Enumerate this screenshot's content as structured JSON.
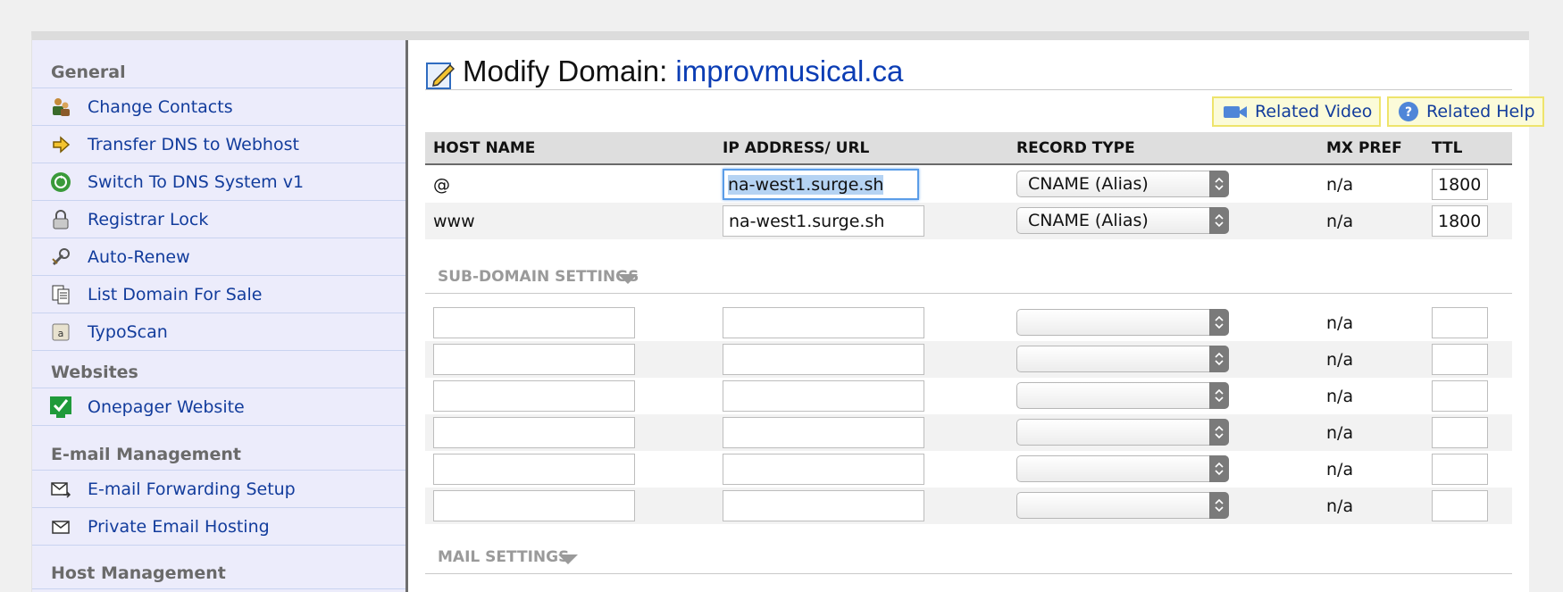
{
  "sidebar": {
    "sections": [
      {
        "heading": "General",
        "items": [
          {
            "label": "Change Contacts",
            "icon": "contacts-icon"
          },
          {
            "label": "Transfer DNS to Webhost",
            "icon": "arrow-right-icon"
          },
          {
            "label": "Switch To DNS System v1",
            "icon": "switch-icon"
          },
          {
            "label": "Registrar Lock",
            "icon": "lock-icon"
          },
          {
            "label": "Auto-Renew",
            "icon": "renew-icon"
          },
          {
            "label": "List Domain For Sale",
            "icon": "document-list-icon"
          },
          {
            "label": "TypoScan",
            "icon": "typoscan-icon"
          }
        ]
      },
      {
        "heading": "Websites",
        "items": [
          {
            "label": "Onepager Website",
            "icon": "checkmark-monitor-icon"
          }
        ]
      },
      {
        "heading": "E-mail Management",
        "items": [
          {
            "label": "E-mail Forwarding Setup",
            "icon": "email-forward-icon"
          },
          {
            "label": "Private Email Hosting",
            "icon": "envelope-icon"
          }
        ]
      },
      {
        "heading": "Host Management",
        "items": []
      }
    ]
  },
  "page": {
    "title_prefix": "Modify Domain: ",
    "domain": "improvmusical.ca",
    "related_video": "Related Video",
    "related_help": "Related Help"
  },
  "table": {
    "headers": {
      "host": "HOST NAME",
      "ip": "IP ADDRESS/ URL",
      "type": "RECORD TYPE",
      "mx": "MX PREF",
      "ttl": "TTL"
    },
    "records": [
      {
        "host": "@",
        "ip": "na-west1.surge.sh",
        "type": "CNAME (Alias)",
        "mx": "n/a",
        "ttl": "1800",
        "focused": true
      },
      {
        "host": "www",
        "ip": "na-west1.surge.sh",
        "type": "CNAME (Alias)",
        "mx": "n/a",
        "ttl": "1800",
        "focused": false
      }
    ]
  },
  "subdomain": {
    "heading": "SUB-DOMAIN SETTINGS",
    "rows": [
      {
        "mx": "n/a"
      },
      {
        "mx": "n/a"
      },
      {
        "mx": "n/a"
      },
      {
        "mx": "n/a"
      },
      {
        "mx": "n/a"
      },
      {
        "mx": "n/a"
      }
    ]
  },
  "mail": {
    "heading": "MAIL SETTINGS"
  }
}
